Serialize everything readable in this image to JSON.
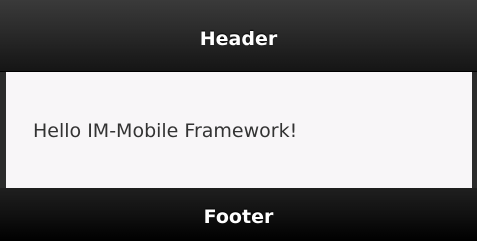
{
  "header": {
    "title": "Header"
  },
  "content": {
    "text": "Hello IM-Mobile Framework!"
  },
  "footer": {
    "title": "Footer"
  },
  "colors": {
    "bar_background": "#1a1a1a",
    "content_background": "#f8f6f8",
    "bar_text": "#ffffff",
    "content_text": "#333333"
  }
}
